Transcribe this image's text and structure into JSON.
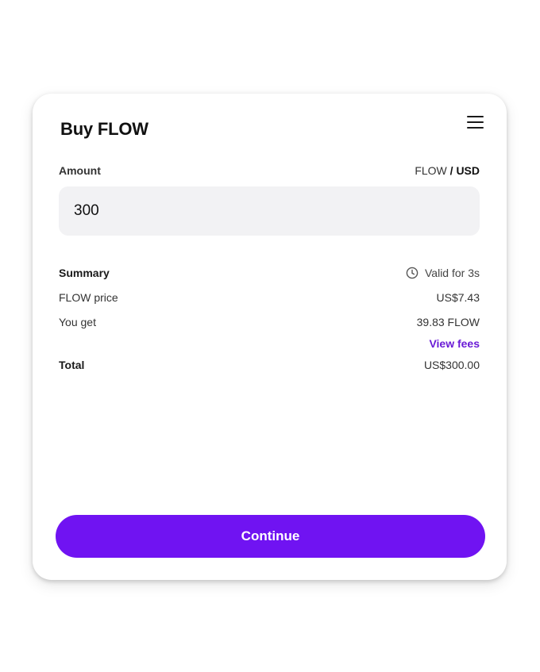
{
  "header": {
    "title": "Buy FLOW",
    "menu_icon": "hamburger-menu-icon"
  },
  "amount": {
    "label": "Amount",
    "currency_crypto": "FLOW",
    "currency_separator": " / ",
    "currency_fiat": "USD",
    "active_currency": "USD",
    "value": "300"
  },
  "summary": {
    "label": "Summary",
    "valid_text": "Valid for 3s",
    "valid_icon": "clock-icon",
    "price_label": "FLOW price",
    "price_value": "US$7.43",
    "get_label": "You get",
    "get_value": "39.83 FLOW",
    "fees_link": "View fees",
    "total_label": "Total",
    "total_value": "US$300.00"
  },
  "actions": {
    "continue_label": "Continue"
  },
  "colors": {
    "accent": "#7013f2",
    "link": "#6a1bd6",
    "input_bg": "#f2f2f4"
  }
}
